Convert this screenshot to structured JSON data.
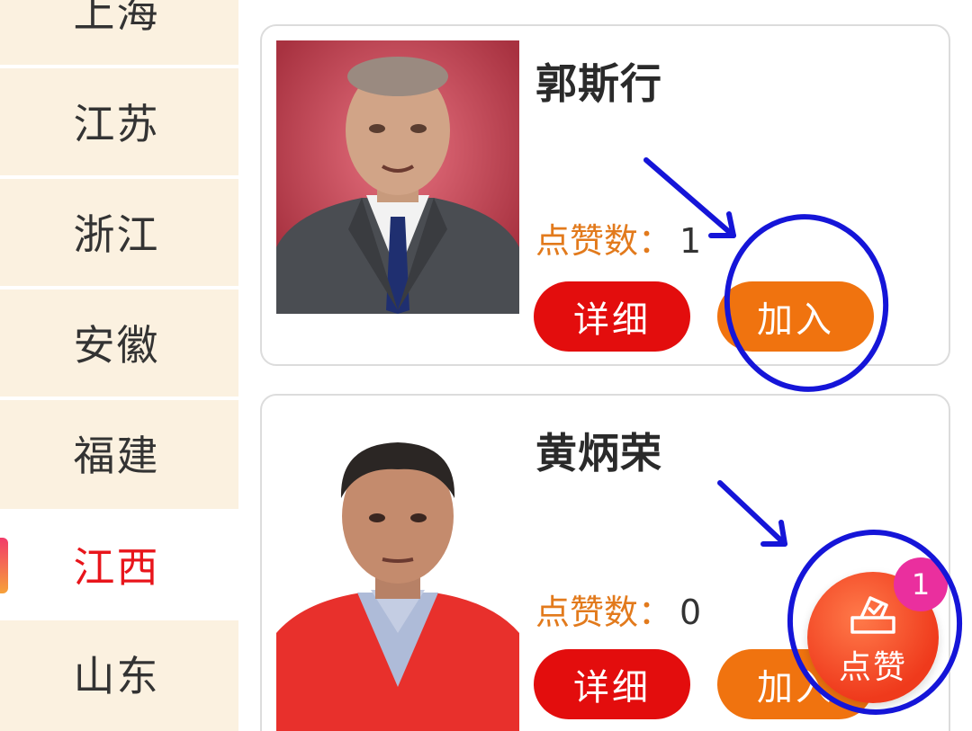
{
  "sidebar": {
    "items": [
      {
        "label": "上海"
      },
      {
        "label": "江苏"
      },
      {
        "label": "浙江"
      },
      {
        "label": "安徽"
      },
      {
        "label": "福建"
      },
      {
        "label": "江西",
        "active": true
      },
      {
        "label": "山东"
      }
    ]
  },
  "candidates": [
    {
      "name": "郭斯行",
      "likes_label": "点赞数：",
      "likes": "1",
      "detail_label": "详细",
      "join_label": "加入"
    },
    {
      "name": "黄炳荣",
      "likes_label": "点赞数：",
      "likes": "0",
      "detail_label": "详细",
      "join_label": "加入"
    }
  ],
  "fab": {
    "label": "点赞",
    "badge": "1"
  },
  "colors": {
    "accent_red": "#e30d0d",
    "accent_orange": "#f0730f",
    "annotation_blue": "#1515d8",
    "sidebar_bg": "#fbf1e0"
  }
}
